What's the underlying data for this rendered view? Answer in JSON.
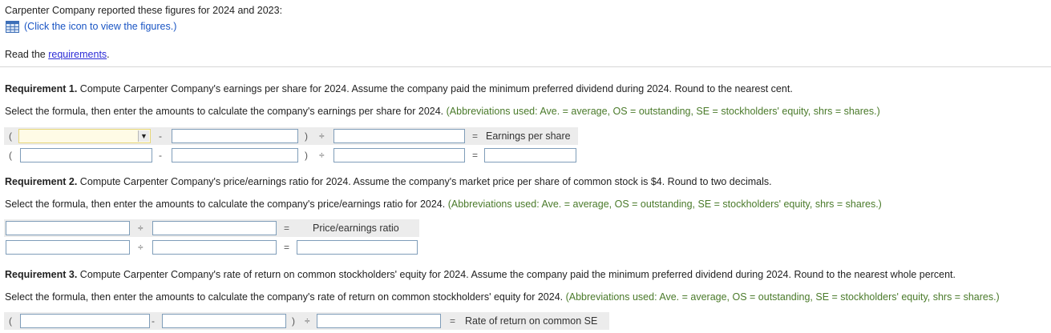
{
  "header": {
    "intro": "Carpenter Company reported these figures for 2024 and 2023:",
    "figures_link": "(Click the icon to view the figures.)",
    "read_prefix": "Read the",
    "requirements_link": "requirements",
    "read_suffix": "."
  },
  "req1": {
    "bold": "Requirement 1.",
    "text": " Compute Carpenter Company's earnings per share for 2024. Assume the company paid the minimum preferred dividend during 2024. Round to the nearest cent.",
    "instruction": "Select the formula, then enter the amounts to calculate the company's earnings per share for 2024.",
    "abbrev": "(Abbreviations used: Ave. = average, OS = outstanding, SE = stockholders' equity, shrs = shares.)",
    "result_label": "Earnings per share"
  },
  "req2": {
    "bold": "Requirement 2.",
    "text": " Compute Carpenter Company's price/earnings ratio for 2024. Assume the company's market price per share of common stock is $4. Round to two decimals.",
    "instruction": "Select the formula, then enter the amounts to calculate the company's price/earnings ratio for 2024.",
    "abbrev": "(Abbreviations used: Ave. = average, OS = outstanding, SE = stockholders' equity, shrs = shares.)",
    "result_label": "Price/earnings ratio"
  },
  "req3": {
    "bold": "Requirement 3.",
    "text": " Compute Carpenter Company's rate of return on common stockholders' equity for 2024. Assume the company paid the minimum preferred dividend during 2024. Round to the nearest whole percent.",
    "instruction": "Select the formula, then enter the amounts to calculate the company's rate of return on common stockholders' equity for 2024.",
    "abbrev": "(Abbreviations used: Ave. = average, OS = outstanding, SE = stockholders' equity, shrs = shares.)",
    "result_label": "Rate of return on common SE"
  },
  "symbols": {
    "open_paren": "(",
    "close_paren": ")",
    "minus": "-",
    "divide": "÷",
    "equals": "=",
    "dropdown_arrow": "▼"
  },
  "icons": {
    "figures": "table-grid-icon"
  },
  "colors": {
    "link": "#1a55c4",
    "abbrev": "#4a7a2a",
    "select_bg": "#fffbe6"
  }
}
